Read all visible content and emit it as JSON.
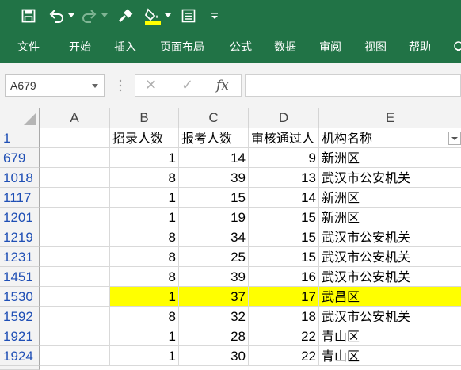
{
  "toolbar": {
    "icons": [
      "save-icon",
      "undo-icon",
      "redo-icon",
      "format-painter-icon",
      "fill-color-icon",
      "form-icon",
      "customize-dropdown-icon"
    ],
    "fill_color": "#ffff00"
  },
  "ribbon": {
    "tabs": [
      "文件",
      "开始",
      "插入",
      "页面布局",
      "公式",
      "数据",
      "审阅",
      "视图",
      "帮助"
    ]
  },
  "formula_bar": {
    "name_box": "A679",
    "cancel_symbol": "✕",
    "enter_symbol": "✓",
    "fx_symbol": "fx",
    "formula": "",
    "annotation_color": "#e03030"
  },
  "sheet": {
    "columns": [
      "A",
      "B",
      "C",
      "D",
      "E"
    ],
    "header_row": {
      "row_number": "1",
      "A": "",
      "B": "招录人数",
      "C": "报考人数",
      "D": "审核通过人",
      "E": "机构名称"
    },
    "rows": [
      {
        "row": "679",
        "B": "1",
        "C": "14",
        "D": "9",
        "E": "新洲区",
        "highlight": false
      },
      {
        "row": "1018",
        "B": "8",
        "C": "39",
        "D": "13",
        "E": "武汉市公安机关",
        "highlight": false
      },
      {
        "row": "1117",
        "B": "1",
        "C": "15",
        "D": "14",
        "E": "新洲区",
        "highlight": false
      },
      {
        "row": "1201",
        "B": "1",
        "C": "19",
        "D": "15",
        "E": "新洲区",
        "highlight": false
      },
      {
        "row": "1219",
        "B": "8",
        "C": "34",
        "D": "15",
        "E": "武汉市公安机关",
        "highlight": false
      },
      {
        "row": "1231",
        "B": "8",
        "C": "25",
        "D": "15",
        "E": "武汉市公安机关",
        "highlight": false
      },
      {
        "row": "1451",
        "B": "8",
        "C": "39",
        "D": "16",
        "E": "武汉市公安机关",
        "highlight": false
      },
      {
        "row": "1530",
        "B": "1",
        "C": "37",
        "D": "17",
        "E": "武昌区",
        "highlight": true
      },
      {
        "row": "1592",
        "B": "8",
        "C": "32",
        "D": "18",
        "E": "武汉市公安机关",
        "highlight": false
      },
      {
        "row": "1921",
        "B": "1",
        "C": "28",
        "D": "22",
        "E": "青山区",
        "highlight": false
      },
      {
        "row": "1924",
        "B": "1",
        "C": "30",
        "D": "22",
        "E": "青山区",
        "highlight": false
      }
    ],
    "highlight_color": "#ffff00",
    "header_bg": "#f3f3f3"
  }
}
